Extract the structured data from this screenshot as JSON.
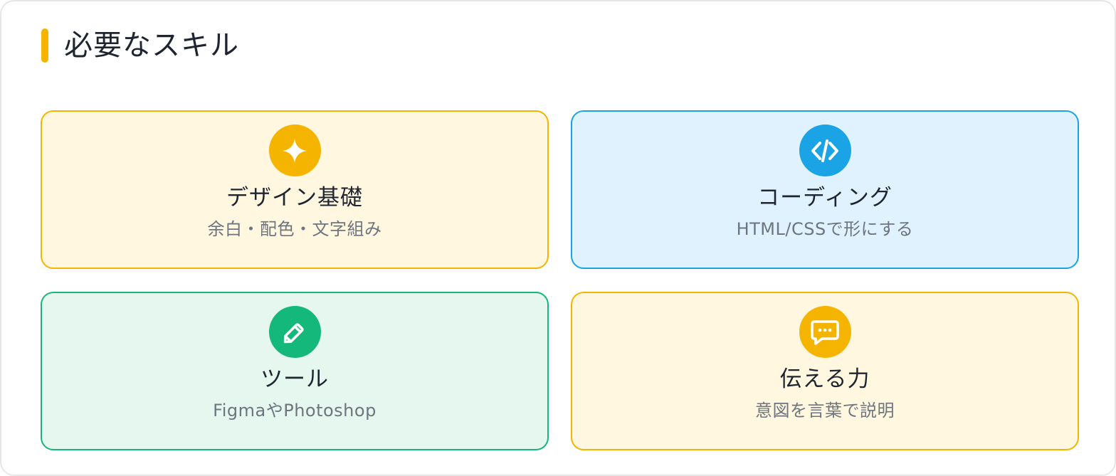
{
  "header": {
    "title": "必要なスキル",
    "accent_color": "#f5b400"
  },
  "cards": [
    {
      "title": "デザイン基礎",
      "subtitle": "余白・配色・文字組み",
      "icon": "sparkle-icon",
      "border_color": "#f5b400",
      "bg_color": "#fff7e0",
      "icon_color": "#f5b400"
    },
    {
      "title": "コーディング",
      "subtitle": "HTML/CSSで形にする",
      "icon": "code-icon",
      "border_color": "#1aa4e6",
      "bg_color": "#e0f2fd",
      "icon_color": "#1aa4e6"
    },
    {
      "title": "ツール",
      "subtitle": "FigmaやPhotoshop",
      "icon": "pencil-icon",
      "border_color": "#14b87a",
      "bg_color": "#e5f7ee",
      "icon_color": "#14b87a"
    },
    {
      "title": "伝える力",
      "subtitle": "意図を言葉で説明",
      "icon": "chat-bubble-icon",
      "border_color": "#f5b400",
      "bg_color": "#fff7e0",
      "icon_color": "#f5b400"
    }
  ]
}
